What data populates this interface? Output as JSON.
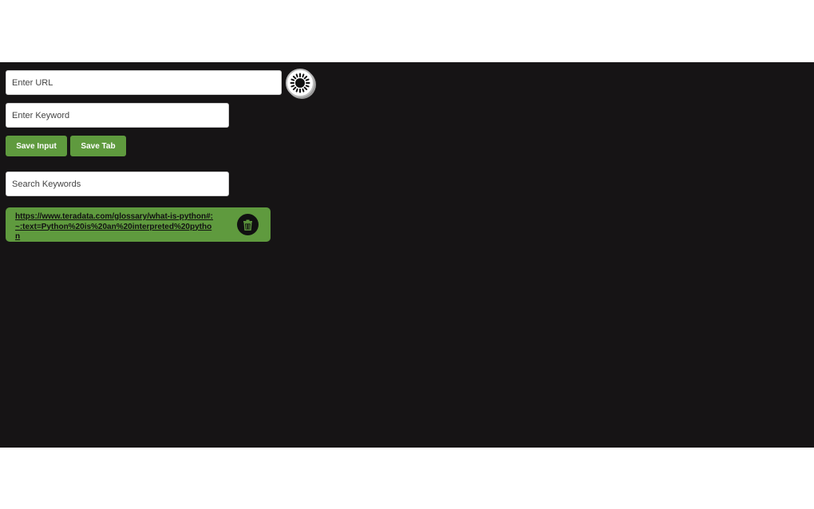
{
  "form": {
    "url_placeholder": "Enter URL",
    "keyword_placeholder": "Enter Keyword",
    "search_placeholder": "Search Keywords",
    "save_input_label": "Save Input",
    "save_tab_label": "Save Tab"
  },
  "theme_toggle": {
    "icon": "sun-icon"
  },
  "saved_links": [
    {
      "url": "https://www.teradata.com/glossary/what-is-python#:~:text=Python%20is%20an%20interpreted%20python",
      "delete_icon": "trash-icon"
    }
  ],
  "colors": {
    "background": "#161415",
    "accent": "#5f9a3e",
    "delete_button": "#111111"
  }
}
